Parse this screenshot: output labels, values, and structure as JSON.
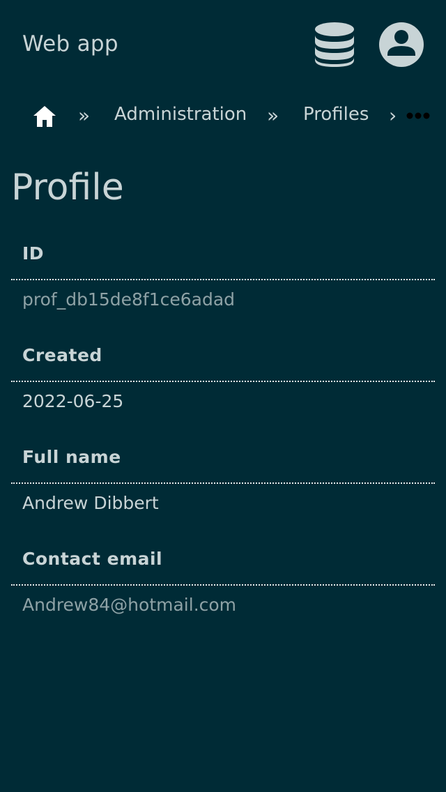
{
  "app_bar": {
    "title": "Web app",
    "icons": {
      "database": "database-icon",
      "account": "account-circle-icon"
    }
  },
  "breadcrumb": {
    "home_icon": "home-icon",
    "separator": "»",
    "items": [
      {
        "label": "Administration"
      },
      {
        "label": "Profiles"
      }
    ],
    "overflow_separator": "›",
    "more_icon": "more-horizontal-icon"
  },
  "page": {
    "title": "Profile"
  },
  "fields": [
    {
      "label": "ID",
      "value": "prof_db15de8f1ce6adad",
      "muted": true
    },
    {
      "label": "Created",
      "value": "2022-06-25",
      "muted": false
    },
    {
      "label": "Full name",
      "value": "Andrew Dibbert",
      "muted": false
    },
    {
      "label": "Contact email",
      "value": "Andrew84@hotmail.com",
      "muted": true
    }
  ],
  "colors": {
    "background": "#002b36",
    "text": "#c8d4d6",
    "muted_text": "#8ea2a6"
  }
}
